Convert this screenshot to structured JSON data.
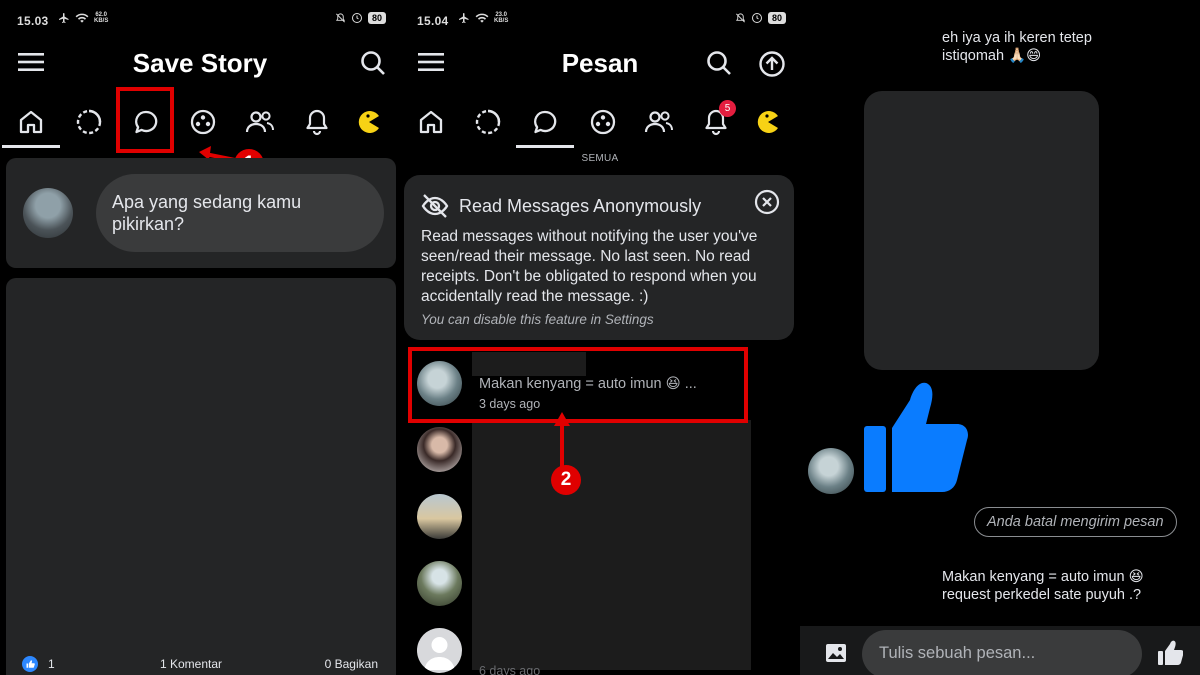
{
  "panel1": {
    "status": {
      "time": "15.03",
      "net_speed": "62.0",
      "net_unit": "KB/S",
      "battery": "80"
    },
    "app_title": "Save Story",
    "composer_placeholder": "Apa yang sedang kamu pikirkan?",
    "annotation_number": "1",
    "post_footer": {
      "likes": "1",
      "comments": "1 Komentar",
      "shares": "0 Bagikan"
    }
  },
  "panel2": {
    "status": {
      "time": "15.04",
      "net_speed": "23.0",
      "net_unit": "KB/S",
      "battery": "80"
    },
    "app_title": "Pesan",
    "notification_count": "5",
    "filter_label": "SEMUA",
    "anon_card": {
      "title": "Read Messages Anonymously",
      "body": "Read messages without notifying the user you've seen/read their message. No last seen. No read receipts. Don't be obligated to respond when you accidentally read the message. :)",
      "hint": "You can disable this feature in Settings"
    },
    "conversations": [
      {
        "preview": "Makan kenyang = auto imun 😆 ...",
        "time": "3 days ago"
      },
      {
        "time": "6 days ago"
      }
    ],
    "annotation_number": "2"
  },
  "panel3": {
    "messages": [
      {
        "text": "eh iya ya ih keren tetep istiqomah 🙏🏻😄"
      },
      {
        "text": "Anda batal mengirim pesan"
      },
      {
        "text": "Makan kenyang = auto imun 😆 request perkedel sate puyuh .?"
      }
    ],
    "composer_placeholder": "Tulis sebuah pesan..."
  },
  "colors": {
    "background": "#000000",
    "card": "#242526",
    "accent_red": "#e00000",
    "like_blue": "#0a7cff",
    "story_yellow": "#f7d215"
  }
}
